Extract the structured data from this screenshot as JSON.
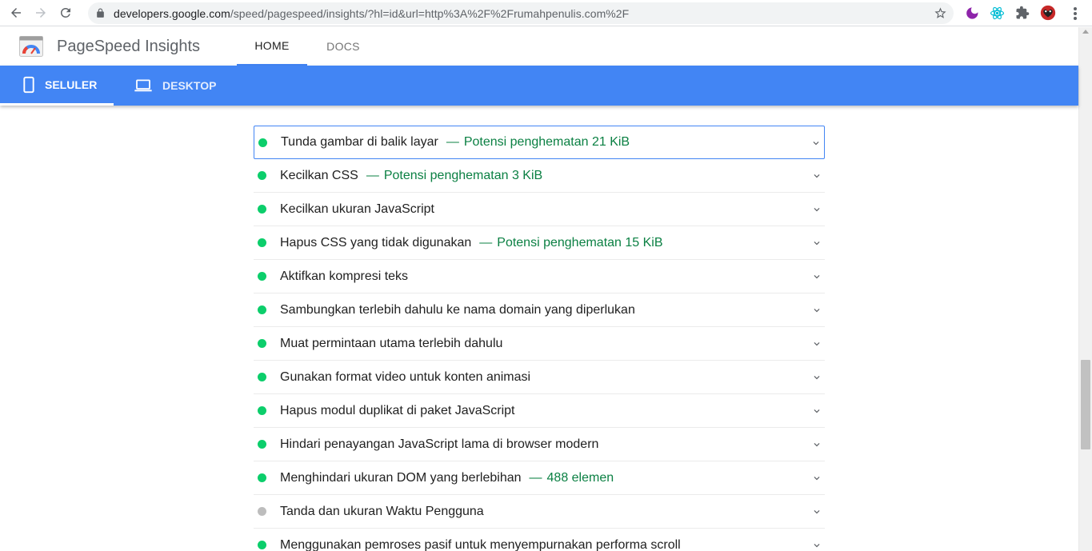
{
  "browser": {
    "url_host": "developers.google.com",
    "url_rest": "/speed/pagespeed/insights/?hl=id&url=http%3A%2F%2Frumahpenulis.com%2F"
  },
  "header": {
    "title": "PageSpeed Insights",
    "tabs": [
      "HOME",
      "DOCS"
    ]
  },
  "device_tabs": {
    "mobile": "SELULER",
    "desktop": "DESKTOP"
  },
  "audits": [
    {
      "title": "Tunda gambar di balik layar",
      "separator": "—",
      "savings": "Potensi penghematan 21 KiB",
      "status": "pass"
    },
    {
      "title": "Kecilkan CSS",
      "separator": "—",
      "savings": "Potensi penghematan 3 KiB",
      "status": "pass"
    },
    {
      "title": "Kecilkan ukuran JavaScript",
      "separator": "",
      "savings": "",
      "status": "pass"
    },
    {
      "title": "Hapus CSS yang tidak digunakan",
      "separator": "—",
      "savings": "Potensi penghematan 15 KiB",
      "status": "pass"
    },
    {
      "title": "Aktifkan kompresi teks",
      "separator": "",
      "savings": "",
      "status": "pass"
    },
    {
      "title": "Sambungkan terlebih dahulu ke nama domain yang diperlukan",
      "separator": "",
      "savings": "",
      "status": "pass"
    },
    {
      "title": "Muat permintaan utama terlebih dahulu",
      "separator": "",
      "savings": "",
      "status": "pass"
    },
    {
      "title": "Gunakan format video untuk konten animasi",
      "separator": "",
      "savings": "",
      "status": "pass"
    },
    {
      "title": "Hapus modul duplikat di paket JavaScript",
      "separator": "",
      "savings": "",
      "status": "pass"
    },
    {
      "title": "Hindari penayangan JavaScript lama di browser modern",
      "separator": "",
      "savings": "",
      "status": "pass"
    },
    {
      "title": "Menghindari ukuran DOM yang berlebihan",
      "separator": "—",
      "savings": "488 elemen",
      "status": "pass"
    },
    {
      "title": "Tanda dan ukuran Waktu Pengguna",
      "separator": "",
      "savings": "",
      "status": "info"
    },
    {
      "title": "Menggunakan pemroses pasif untuk menyempurnakan performa scroll",
      "separator": "",
      "savings": "",
      "status": "pass"
    }
  ],
  "colors": {
    "accent_blue": "#4285f4",
    "pass_green": "#0cce6b",
    "savings_green": "#0b8043",
    "info_gray": "#bdbdbd"
  }
}
